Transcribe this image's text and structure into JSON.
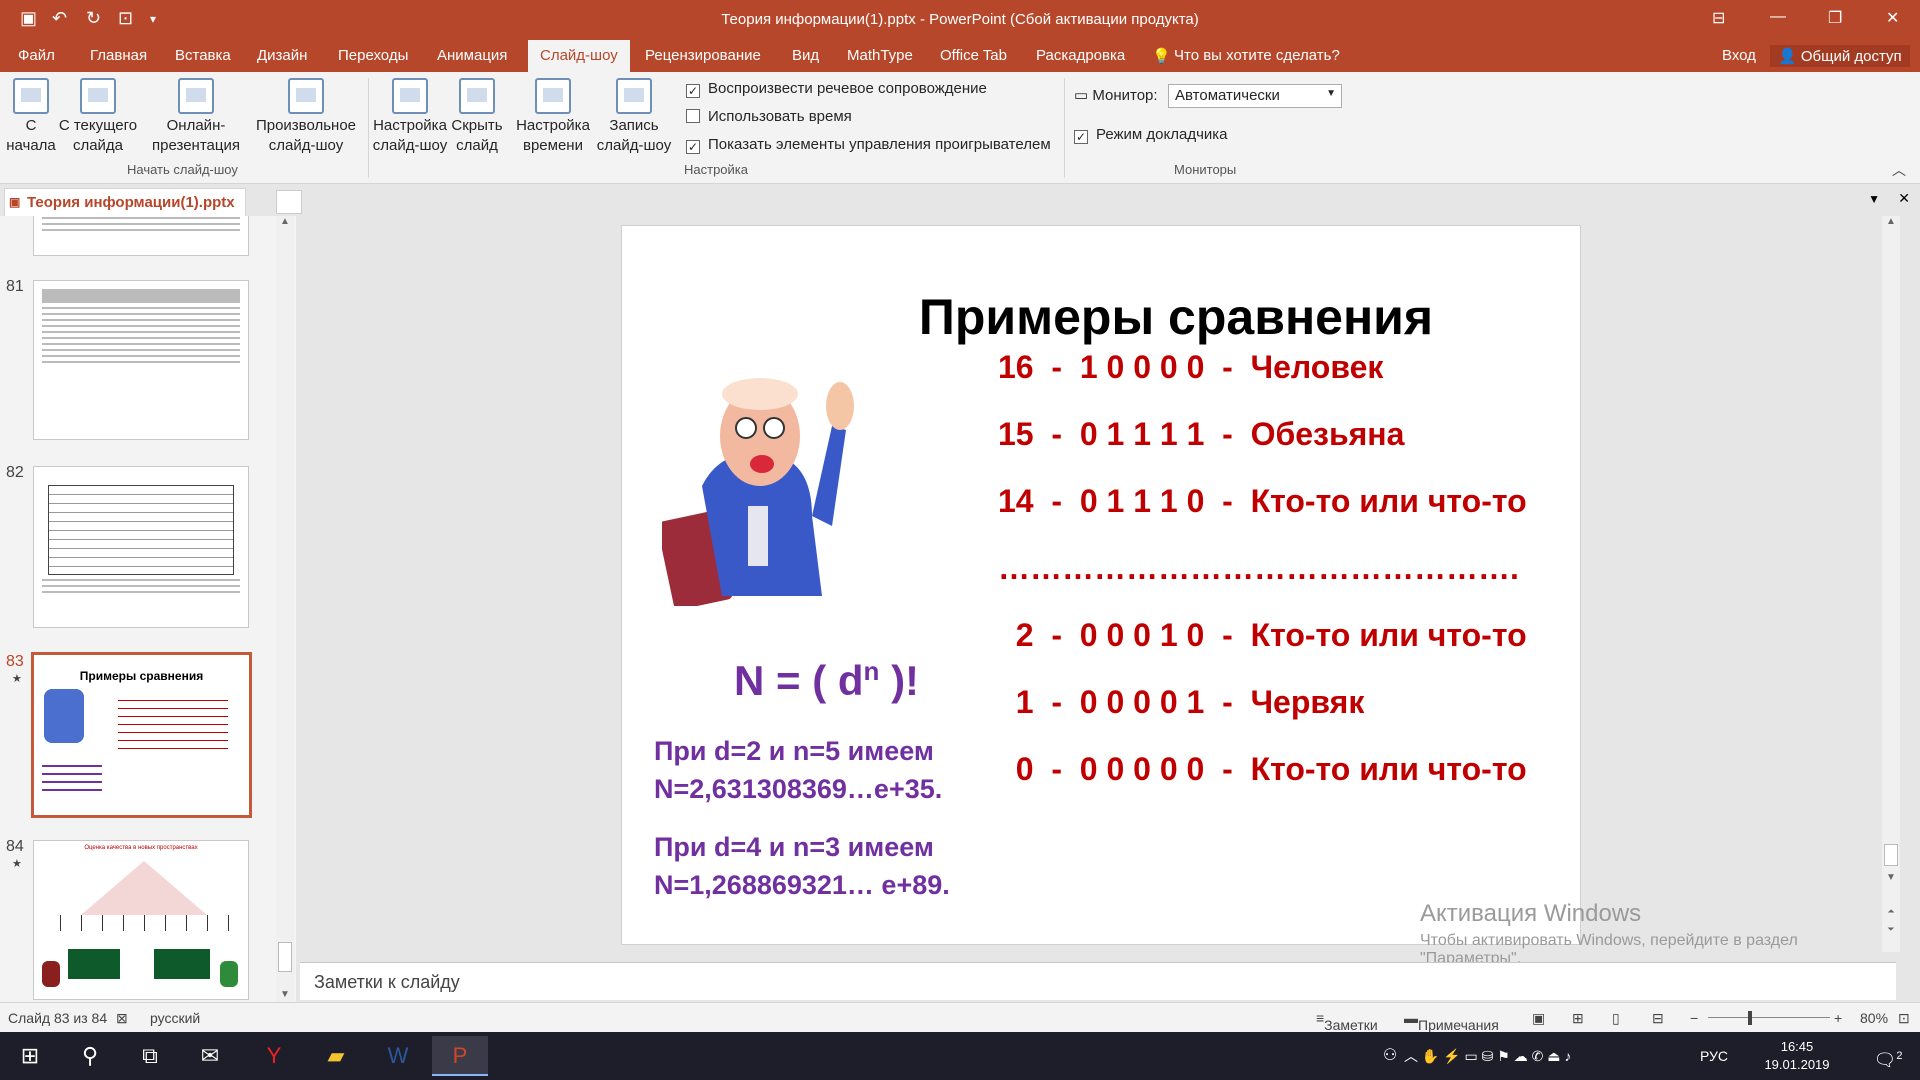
{
  "window": {
    "title": "Теория информации(1).pptx - PowerPoint (Сбой активации продукта)"
  },
  "menu": {
    "tabs": [
      "Файл",
      "Главная",
      "Вставка",
      "Дизайн",
      "Переходы",
      "Анимация",
      "Слайд-шоу",
      "Рецензирование",
      "Вид",
      "MathType",
      "Office Tab",
      "Раскадровка"
    ],
    "search": "Что вы хотите сделать?",
    "signin": "Вход",
    "share": "Общий доступ"
  },
  "ribbon": {
    "start": {
      "from_begin": "С начала",
      "from_current": "С текущего слайда",
      "online": "Онлайн-презентация",
      "custom": "Произвольное слайд-шоу",
      "group": "Начать слайд-шоу"
    },
    "setup": {
      "setup_show": "Настройка слайд-шоу",
      "hide": "Скрыть слайд",
      "rehearse": "Настройка времени",
      "record": "Запись слайд-шоу",
      "chk_narration": "Воспроизвести речевое сопровождение",
      "chk_timing": "Использовать время",
      "chk_controls": "Показать элементы управления проигрывателем",
      "group": "Настройка"
    },
    "monitors": {
      "label": "Монитор:",
      "value": "Автоматически",
      "presenter": "Режим докладчика",
      "group": "Мониторы"
    }
  },
  "doc_tab": "Теория информации(1).pptx",
  "thumbnails": [
    {
      "num": "81"
    },
    {
      "num": "82"
    },
    {
      "num": "83",
      "title": "Примеры сравнения"
    },
    {
      "num": "84",
      "title": "Оценка качества в новых пространствах"
    }
  ],
  "slide": {
    "title": "Примеры сравнения",
    "rows": [
      "16  -  1 0 0 0 0  -  Человек",
      "15  -  0 1 1 1 1  -  Обезьяна",
      "14  -  0 1 1 1 0  -  Кто-то или что-то",
      "………………………………………….",
      "  2  -  0 0 0 1 0  -  Кто-то или что-то",
      "  1  -  0 0 0 0 1  -  Червяк",
      "  0  -  0 0 0 0 0  -  Кто-то или что-то"
    ],
    "formula": "N = ( d",
    "formula_exp": "n",
    "formula_end": " )!",
    "p1a": "При d=2 и n=5 имеем",
    "p1b": "N=2,631308369…e+35.",
    "p2a": "При d=4 и n=3 имеем",
    "p2b": "N=1,268869321… e+89."
  },
  "notes": "Заметки к слайду",
  "activation": {
    "title": "Активация Windows",
    "text": "Чтобы активировать Windows, перейдите в раздел \"Параметры\"."
  },
  "status": {
    "slide": "Слайд 83 из 84",
    "lang": "русский",
    "notes": "Заметки",
    "comments": "Примечания",
    "zoom": "80%"
  },
  "taskbar": {
    "lang": "РУС",
    "time": "16:45",
    "date": "19.01.2019",
    "notify": "2"
  }
}
